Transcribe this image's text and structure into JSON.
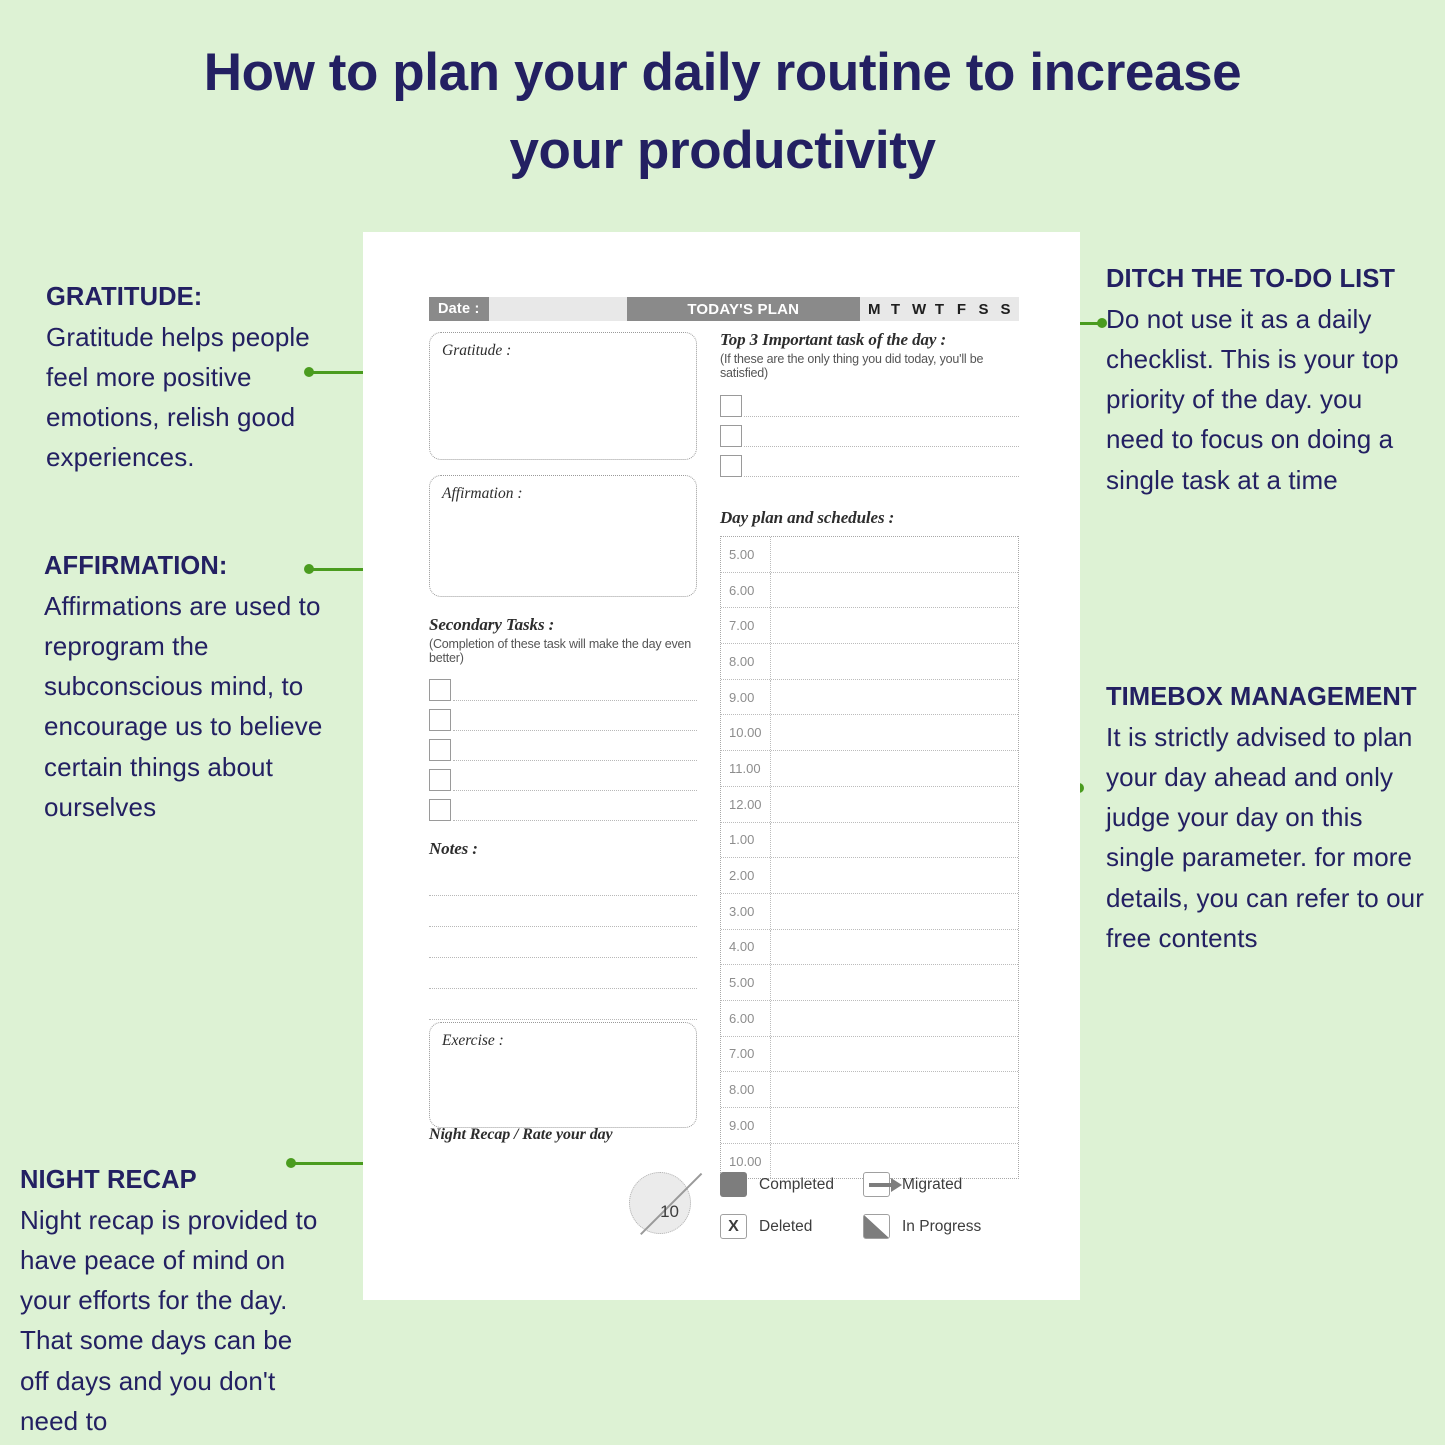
{
  "theme": {
    "bg": "#ddf2d4",
    "navy": "#232062",
    "green": "#4a9c1f",
    "page_bg": "#ffffff",
    "gray_dark": "#8a8a8a",
    "gray_light": "#e8e8e8"
  },
  "title": "How to plan your daily routine to increase your productivity",
  "annotations": {
    "gratitude": {
      "heading": "GRATITUDE:",
      "body": "Gratitude helps people feel more positive emotions, relish good experiences."
    },
    "affirmation": {
      "heading": "AFFIRMATION:",
      "body": "Affirmations are used to reprogram the subconscious mind, to encourage us to believe certain things about ourselves"
    },
    "night_recap": {
      "heading": "NIGHT RECAP",
      "body": "Night recap is provided to have peace of mind on your efforts for the day. That some days can be off days and you don't need to"
    },
    "ditch": {
      "heading": "DITCH THE TO-DO LIST",
      "body": "Do not use it as a daily checklist. This is your top priority of the day. you need to focus on doing a single task at a time"
    },
    "timebox": {
      "heading": "TIMEBOX MANAGEMENT",
      "body": "It is strictly advised to plan your day ahead and only judge your day on this single parameter. for more details, you can refer to our free contents"
    }
  },
  "planner": {
    "header": {
      "date_label": "Date :",
      "title": "TODAY'S PLAN",
      "days": [
        "M",
        "T",
        "W",
        "T",
        "F",
        "S",
        "S"
      ]
    },
    "gratitude_label": "Gratitude :",
    "affirmation_label": "Affirmation :",
    "top3": {
      "heading": "Top 3 Important task of the day :",
      "subtext": "(If these are the only thing you did today, you'll be satisfied)",
      "rows": 3
    },
    "secondary": {
      "heading": "Secondary Tasks :",
      "subtext": "(Completion of these task will make the day even better)",
      "rows": 5
    },
    "notes_label": "Notes :",
    "notes_lines": 5,
    "exercise_label": "Exercise :",
    "night_recap_label": "Night Recap / Rate your day",
    "schedule": {
      "heading": "Day plan and schedules :",
      "times": [
        "5.00",
        "6.00",
        "7.00",
        "8.00",
        "9.00",
        "10.00",
        "11.00",
        "12.00",
        "1.00",
        "2.00",
        "3.00",
        "4.00",
        "5.00",
        "6.00",
        "7.00",
        "8.00",
        "9.00",
        "10.00"
      ]
    },
    "rating": {
      "value": "10"
    },
    "legend": [
      {
        "icon": "filled-square-icon",
        "label": "Completed"
      },
      {
        "icon": "arrow-right-icon",
        "label": "Migrated"
      },
      {
        "icon": "x-box-icon",
        "label": "Deleted"
      },
      {
        "icon": "half-filled-icon",
        "label": "In Progress"
      }
    ]
  }
}
